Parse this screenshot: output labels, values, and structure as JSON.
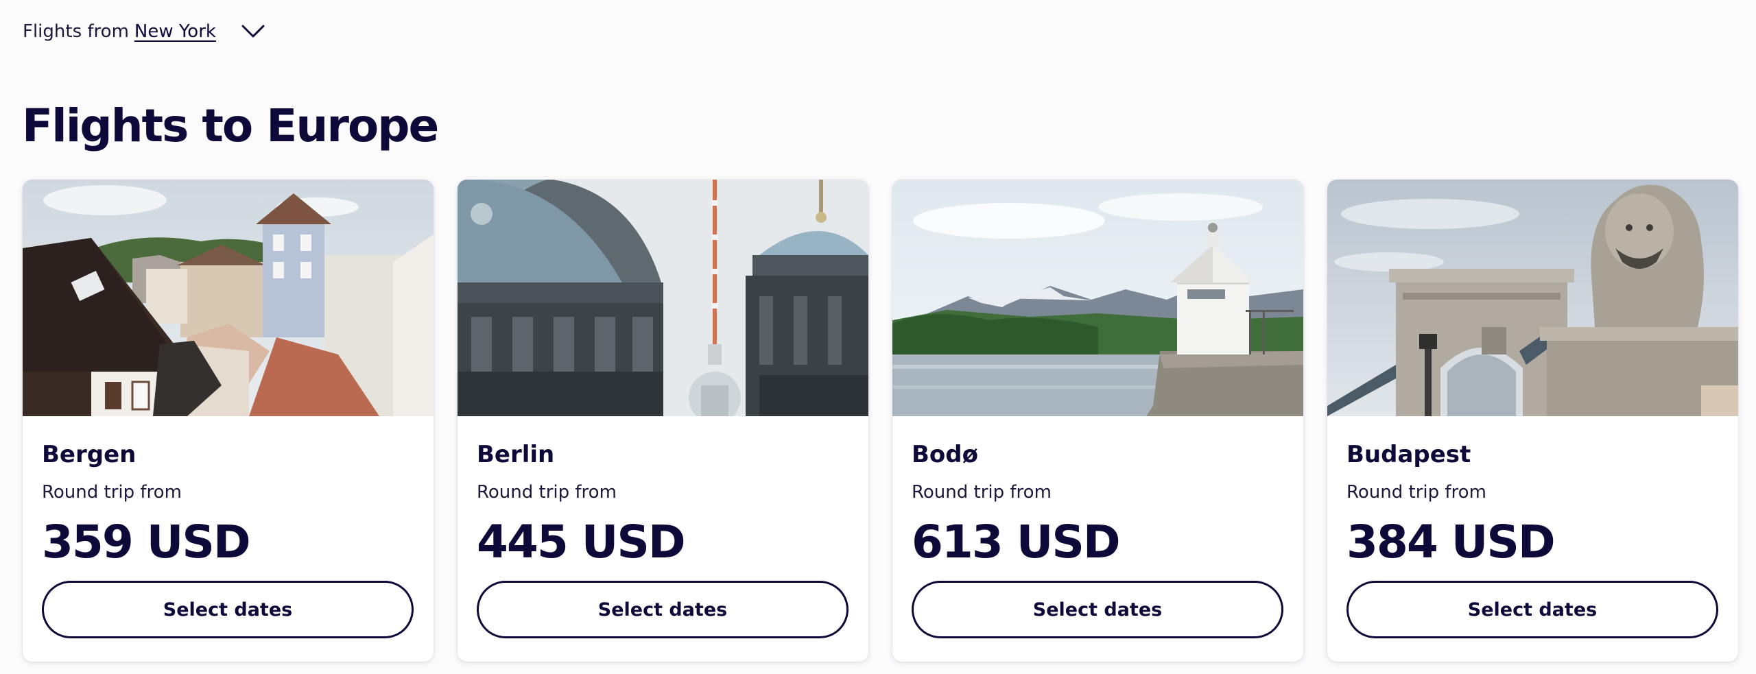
{
  "origin": {
    "prefix": "Flights from",
    "city": "New York",
    "chevron_icon": "chevron-down-icon"
  },
  "page_title": "Flights to Europe",
  "cards": [
    {
      "city": "Bergen",
      "caption": "Round trip from",
      "price": "359 USD",
      "button_label": "Select dates",
      "image_icon": "bergen-rooftops-photo"
    },
    {
      "city": "Berlin",
      "caption": "Round trip from",
      "price": "445 USD",
      "button_label": "Select dates",
      "image_icon": "berlin-cathedral-tv-tower-photo"
    },
    {
      "city": "Bodø",
      "caption": "Round trip from",
      "price": "613 USD",
      "button_label": "Select dates",
      "image_icon": "bodo-lighthouse-fjord-photo"
    },
    {
      "city": "Budapest",
      "caption": "Round trip from",
      "price": "384 USD",
      "button_label": "Select dates",
      "image_icon": "budapest-chain-bridge-lion-photo"
    }
  ],
  "colors": {
    "brand_navy": "#0d0a3a",
    "page_background": "#fbfbfc",
    "card_background": "#ffffff"
  }
}
